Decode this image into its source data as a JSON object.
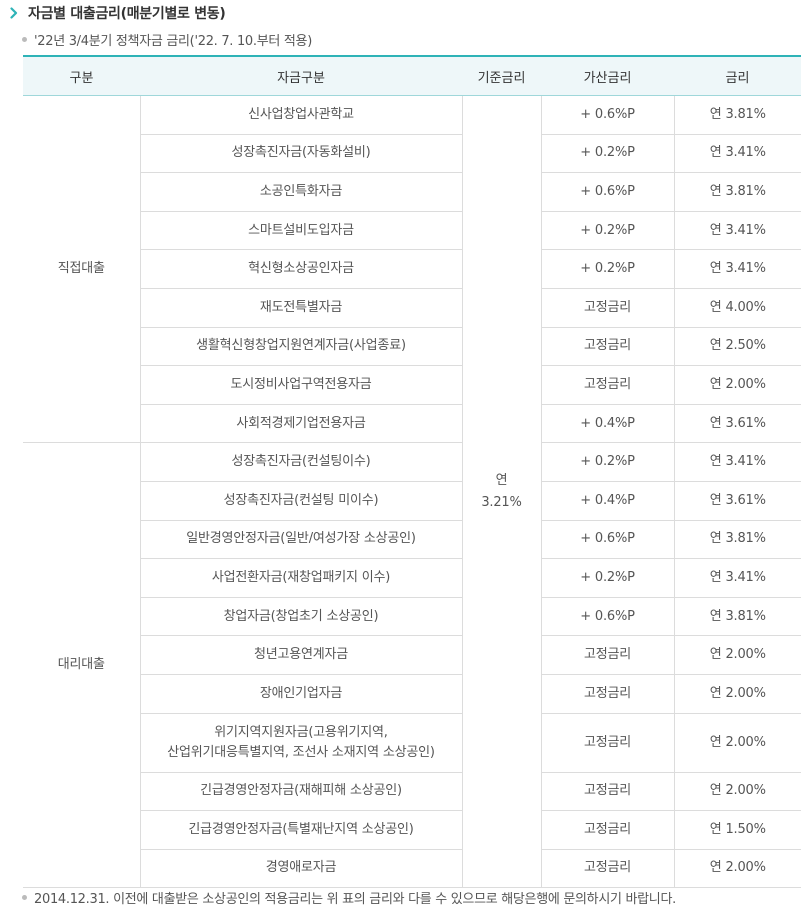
{
  "header": {
    "title": "자금별 대출금리(매분기별로 변동)",
    "subtitle": "'22년 3/4분기 정책자금 금리('22. 7. 10.부터 적용)"
  },
  "table": {
    "columns": [
      "구분",
      "자금구분",
      "기준금리",
      "가산금리",
      "금리"
    ],
    "base_rate": {
      "line1": "연",
      "line2": "3.21%"
    },
    "groups": [
      {
        "category": "직접대출",
        "rows": [
          {
            "fund": "신사업창업사관학교",
            "add": "+ 0.6%P",
            "rate": "연 3.81%"
          },
          {
            "fund": "성장촉진자금(자동화설비)",
            "add": "+ 0.2%P",
            "rate": "연 3.41%"
          },
          {
            "fund": "소공인특화자금",
            "add": "+ 0.6%P",
            "rate": "연 3.81%"
          },
          {
            "fund": "스마트설비도입자금",
            "add": "+ 0.2%P",
            "rate": "연 3.41%"
          },
          {
            "fund": "혁신형소상공인자금",
            "add": "+ 0.2%P",
            "rate": "연 3.41%"
          },
          {
            "fund": "재도전특별자금",
            "add": "고정금리",
            "rate": "연 4.00%"
          },
          {
            "fund": "생활혁신형창업지원연계자금(사업종료)",
            "add": "고정금리",
            "rate": "연 2.50%"
          },
          {
            "fund": "도시정비사업구역전용자금",
            "add": "고정금리",
            "rate": "연 2.00%"
          },
          {
            "fund": "사회적경제기업전용자금",
            "add": "+ 0.4%P",
            "rate": "연 3.61%"
          }
        ]
      },
      {
        "category": "대리대출",
        "rows": [
          {
            "fund": "성장촉진자금(컨설팅이수)",
            "add": "+ 0.2%P",
            "rate": "연 3.41%"
          },
          {
            "fund": "성장촉진자금(컨설팅 미이수)",
            "add": "+ 0.4%P",
            "rate": "연 3.61%"
          },
          {
            "fund": "일반경영안정자금(일반/여성가장 소상공인)",
            "add": "+ 0.6%P",
            "rate": "연 3.81%"
          },
          {
            "fund": "사업전환자금(재창업패키지 이수)",
            "add": "+ 0.2%P",
            "rate": "연 3.41%"
          },
          {
            "fund": "창업자금(창업초기 소상공인)",
            "add": "+ 0.6%P",
            "rate": "연 3.81%"
          },
          {
            "fund": "청년고용연계자금",
            "add": "고정금리",
            "rate": "연 2.00%"
          },
          {
            "fund": "장애인기업자금",
            "add": "고정금리",
            "rate": "연 2.00%"
          },
          {
            "fund": "위기지역지원자금(고용위기지역,\n산업위기대응특별지역, 조선사 소재지역 소상공인)",
            "add": "고정금리",
            "rate": "연 2.00%",
            "tall": true
          },
          {
            "fund": "긴급경영안정자금(재해피해 소상공인)",
            "add": "고정금리",
            "rate": "연 2.00%"
          },
          {
            "fund": "긴급경영안정자금(특별재난지역 소상공인)",
            "add": "고정금리",
            "rate": "연 1.50%"
          },
          {
            "fund": "경영애로자금",
            "add": "고정금리",
            "rate": "연 2.00%"
          }
        ]
      }
    ]
  },
  "footnote": "2014.12.31. 이전에 대출받은 소상공인의 적용금리는 위 표의 금리와 다를 수 있으므로 해당은행에 문의하시기 바랍니다.",
  "colors": {
    "accent": "#2eb3b7",
    "header_bg": "#eef7f9",
    "border": "#dcdcdc"
  },
  "icons": {
    "title": "chevron-right-icon",
    "list": "bullet-dot-icon"
  }
}
